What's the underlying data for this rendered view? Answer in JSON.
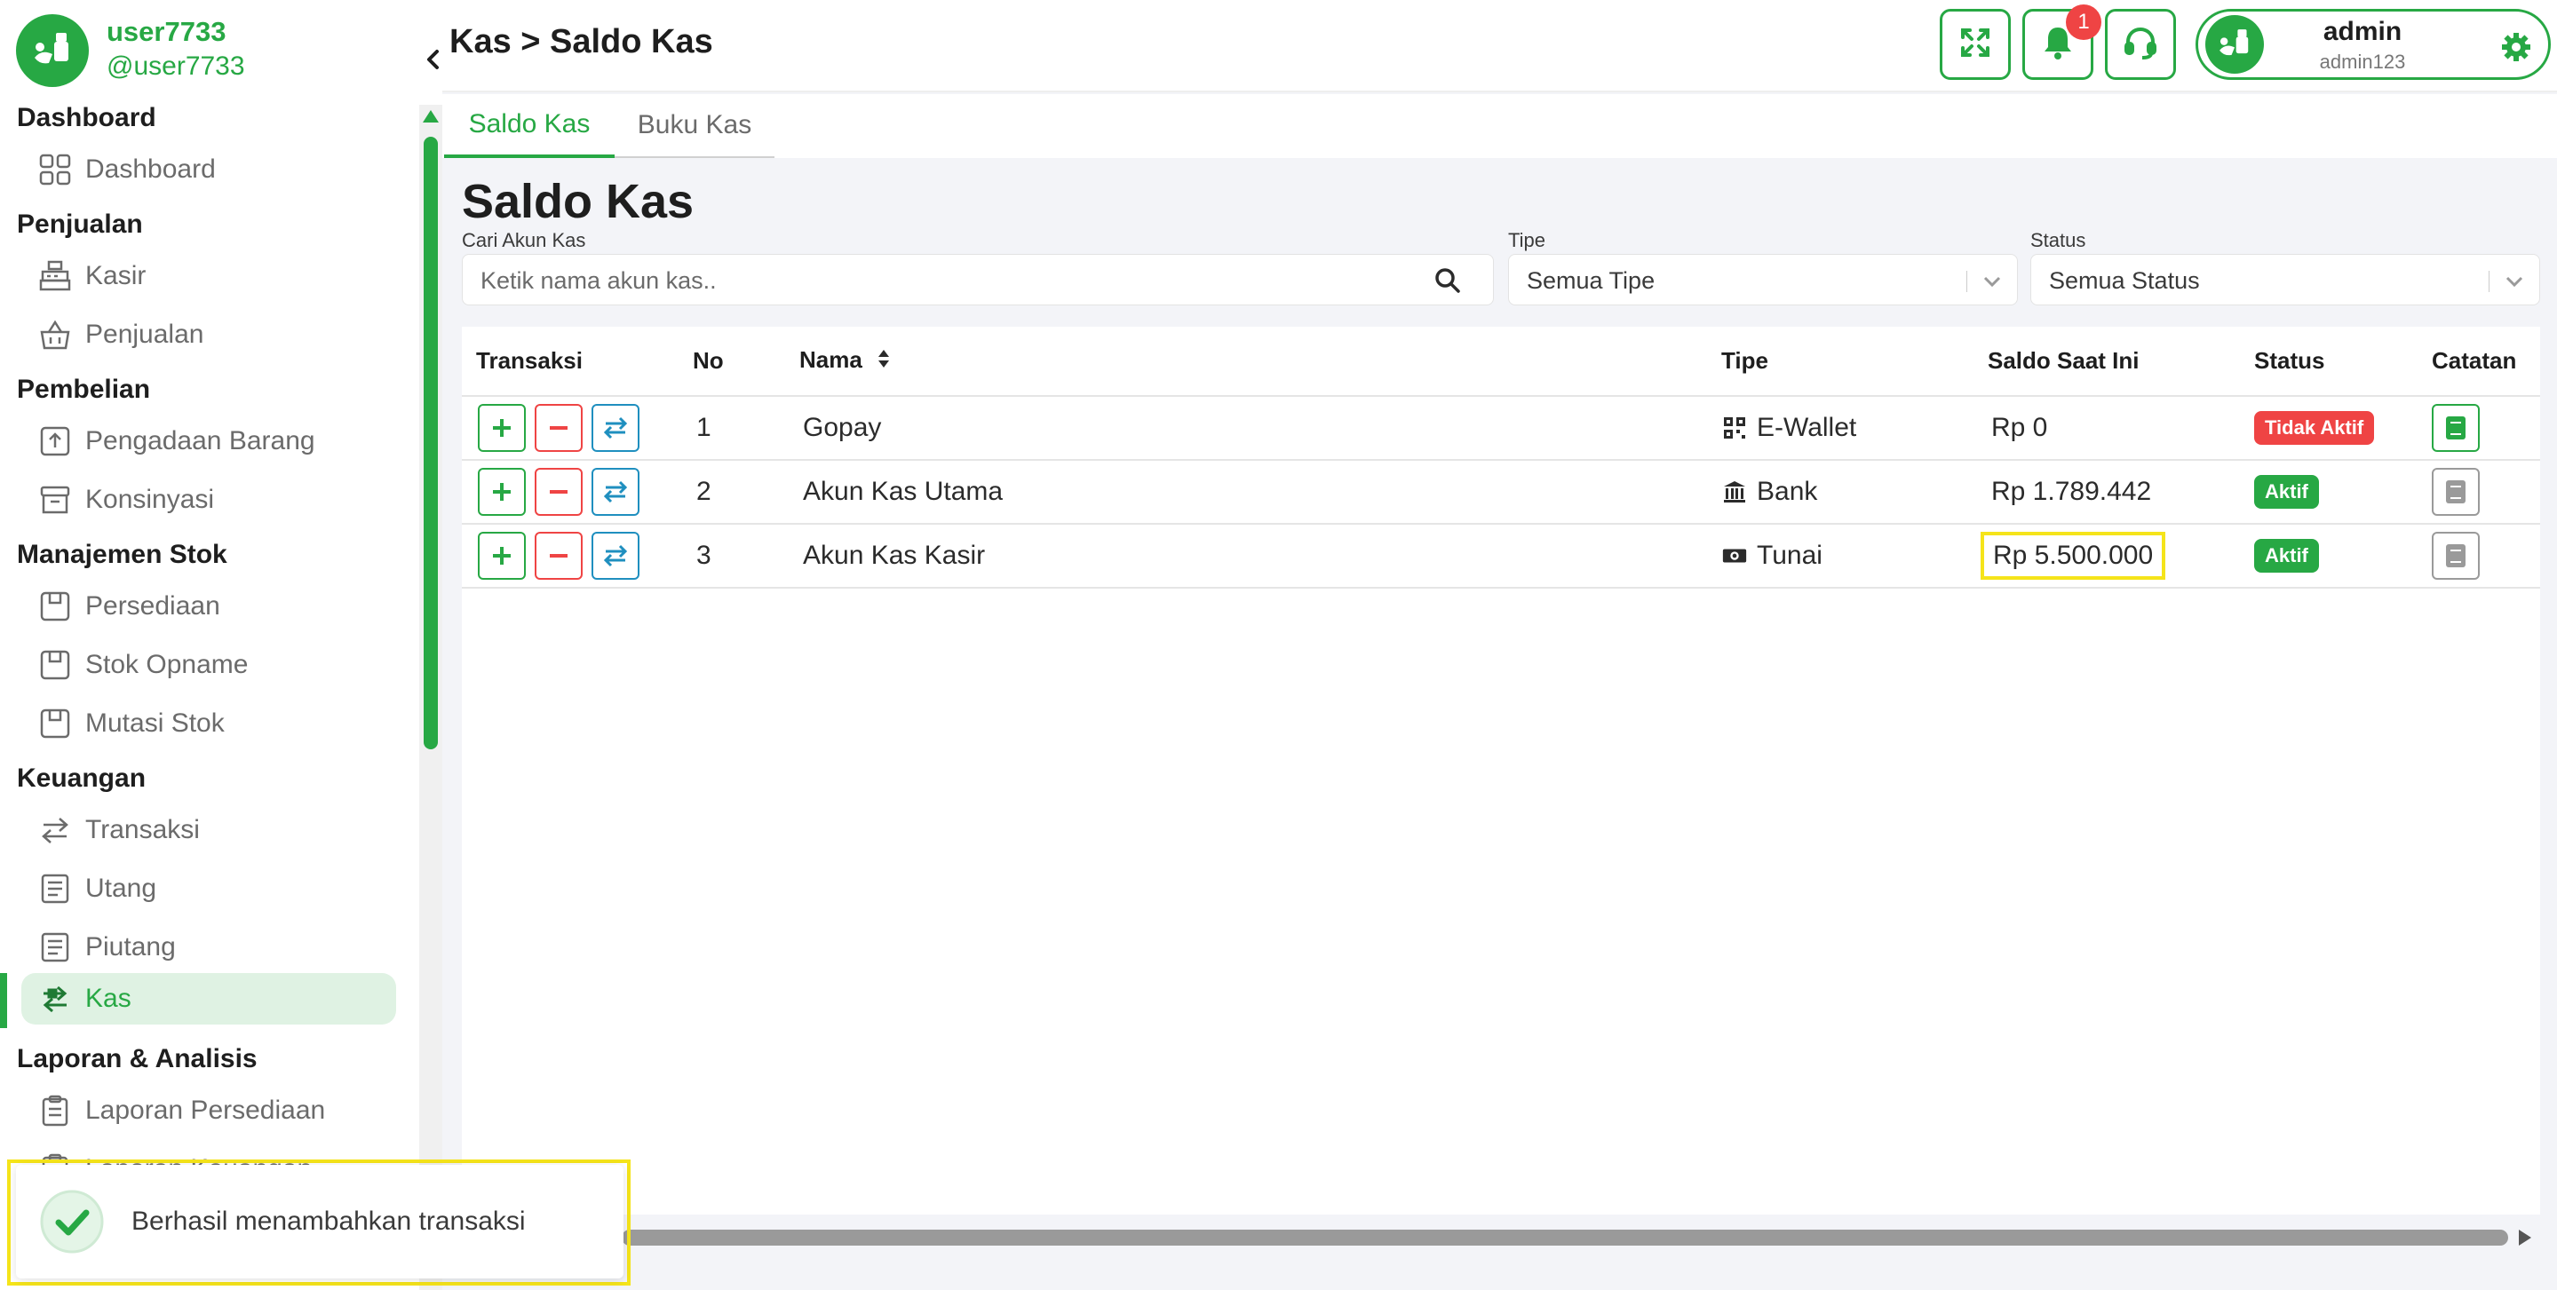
{
  "sidebar": {
    "username": "user7733",
    "handle": "@user7733",
    "sections": [
      {
        "title": "Dashboard",
        "items": [
          {
            "label": "Dashboard",
            "icon": "grid-icon"
          }
        ]
      },
      {
        "title": "Penjualan",
        "items": [
          {
            "label": "Kasir",
            "icon": "cash-register-icon"
          },
          {
            "label": "Penjualan",
            "icon": "basket-icon"
          }
        ]
      },
      {
        "title": "Pembelian",
        "items": [
          {
            "label": "Pengadaan Barang",
            "icon": "upload-box-icon"
          },
          {
            "label": "Konsinyasi",
            "icon": "archive-icon"
          }
        ]
      },
      {
        "title": "Manajemen Stok",
        "items": [
          {
            "label": "Persediaan",
            "icon": "inventory-icon"
          },
          {
            "label": "Stok Opname",
            "icon": "inventory-icon"
          },
          {
            "label": "Mutasi Stok",
            "icon": "inventory-icon"
          }
        ]
      },
      {
        "title": "Keuangan",
        "items": [
          {
            "label": "Transaksi",
            "icon": "transfer-icon"
          },
          {
            "label": "Utang",
            "icon": "receipt-icon"
          },
          {
            "label": "Piutang",
            "icon": "receipt-icon"
          },
          {
            "label": "Kas",
            "icon": "cash-transfer-icon"
          }
        ]
      },
      {
        "title": "Laporan & Analisis",
        "items": [
          {
            "label": "Laporan Persediaan",
            "icon": "clipboard-icon"
          },
          {
            "label": "Laporan Keuangan",
            "icon": "clipboard-icon"
          }
        ]
      }
    ],
    "active_item": "Kas"
  },
  "header": {
    "breadcrumb": "Kas > Saldo Kas",
    "notification_count": "1",
    "profile_name": "admin",
    "profile_sub": "admin123"
  },
  "tabs": [
    {
      "label": "Saldo Kas",
      "active": true
    },
    {
      "label": "Buku Kas",
      "active": false
    }
  ],
  "main": {
    "title": "Saldo Kas",
    "search_label": "Cari Akun Kas",
    "search_placeholder": "Ketik nama akun kas..",
    "tipe_label": "Tipe",
    "tipe_value": "Semua Tipe",
    "status_label": "Status",
    "status_value": "Semua Status"
  },
  "table": {
    "columns": [
      "Transaksi",
      "No",
      "Nama",
      "Tipe",
      "Saldo Saat Ini",
      "Status",
      "Catatan"
    ],
    "rows": [
      {
        "no": "1",
        "nama": "Gopay",
        "tipe": "E-Wallet",
        "tipe_icon": "qr-icon",
        "saldo": "Rp 0",
        "status": "Tidak Aktif",
        "status_color": "#ef4444",
        "note_active": true
      },
      {
        "no": "2",
        "nama": "Akun Kas Utama",
        "tipe": "Bank",
        "tipe_icon": "bank-icon",
        "saldo": "Rp 1.789.442",
        "status": "Aktif",
        "status_color": "#27a844",
        "note_active": false
      },
      {
        "no": "3",
        "nama": "Akun Kas Kasir",
        "tipe": "Tunai",
        "tipe_icon": "cash-icon",
        "saldo": "Rp 5.500.000",
        "status": "Aktif",
        "status_color": "#27a844",
        "note_active": false
      }
    ]
  },
  "toast": {
    "message": "Berhasil menambahkan transaksi"
  },
  "colors": {
    "primary": "#27a844",
    "danger": "#ef4444",
    "info": "#1f8fbf",
    "highlight": "#f5e41a"
  }
}
